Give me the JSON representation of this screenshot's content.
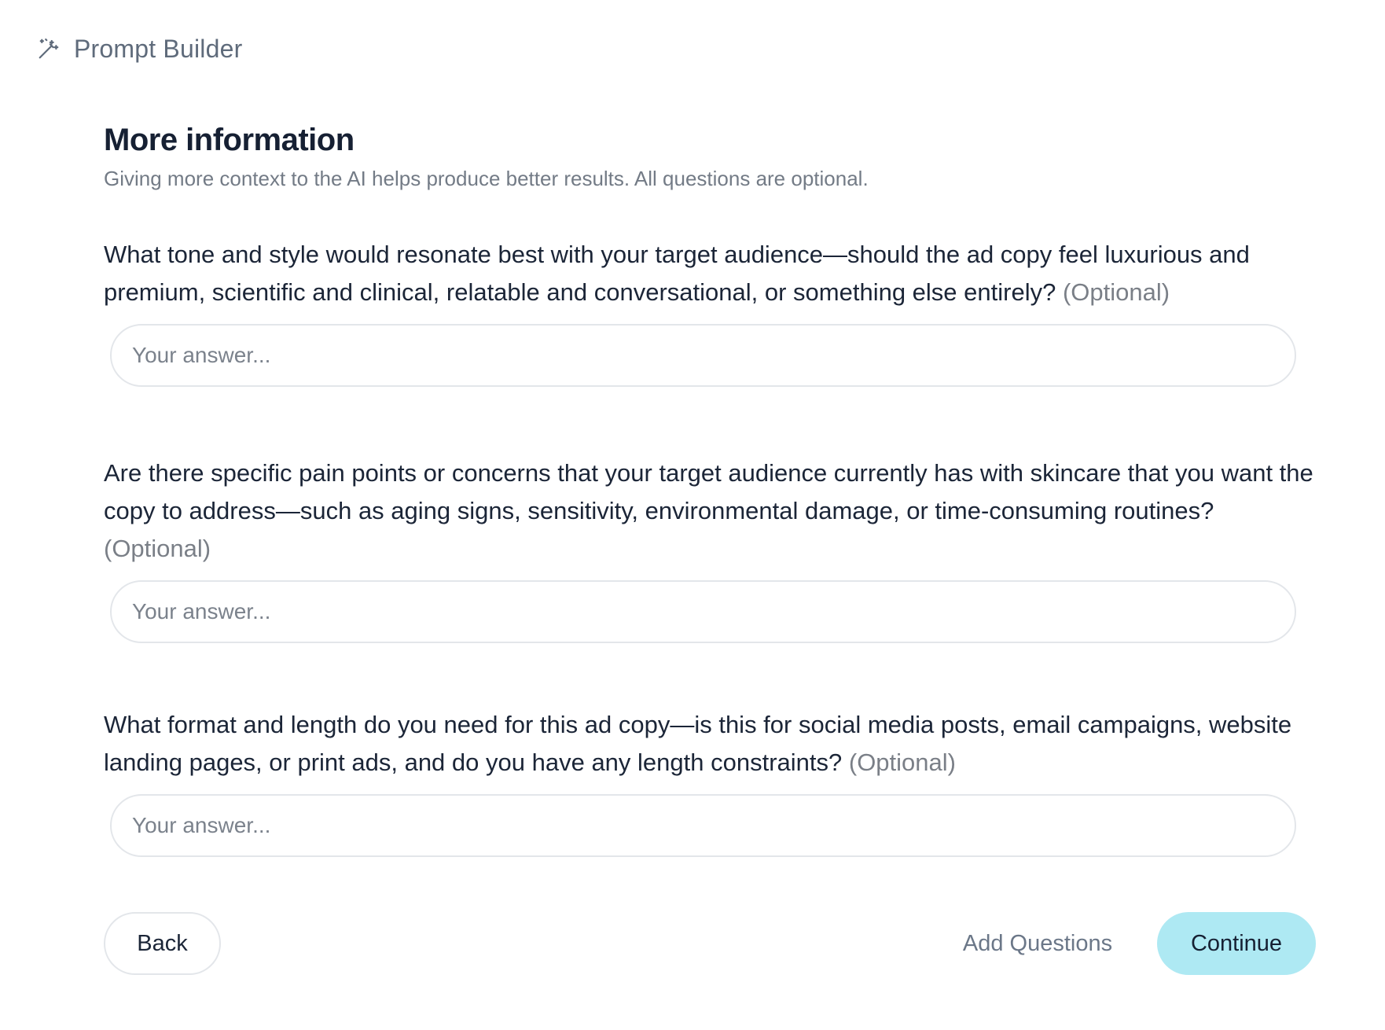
{
  "header": {
    "title": "Prompt Builder",
    "icon": "magic-wand-icon"
  },
  "main": {
    "title": "More information",
    "subtitle": "Giving more context to the AI helps produce better results. All questions are optional.",
    "questions": [
      {
        "text": "What tone and style would resonate best with your target audience—should the ad copy feel luxurious and premium, scientific and clinical, relatable and conversational, or something else entirely?",
        "optional_label": "(Optional)",
        "answer_value": "",
        "answer_placeholder": "Your answer..."
      },
      {
        "text": "Are there specific pain points or concerns that your target audience currently has with skincare that you want the copy to address—such as aging signs, sensitivity, environmental damage, or time-consuming routines?",
        "optional_label": "(Optional)",
        "answer_value": "",
        "answer_placeholder": "Your answer..."
      },
      {
        "text": "What format and length do you need for this ad copy—is this for social media posts, email campaigns, website landing pages, or print ads, and do you have any length constraints?",
        "optional_label": "(Optional)",
        "answer_value": "",
        "answer_placeholder": "Your answer..."
      }
    ]
  },
  "footer": {
    "back_label": "Back",
    "add_questions_label": "Add Questions",
    "continue_label": "Continue"
  },
  "colors": {
    "continue_bg": "#aee9f3",
    "title_text": "#162033",
    "muted_text": "#737b86",
    "border": "#e3e6ea"
  }
}
